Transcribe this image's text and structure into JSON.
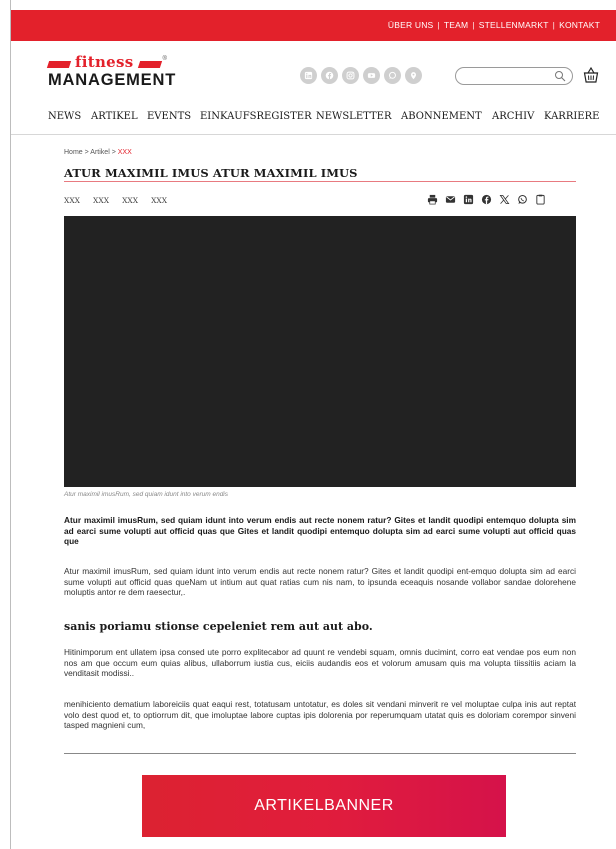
{
  "colors": {
    "brand_red": "#e3212b",
    "video_bg": "#222222",
    "icon_grey": "#cfcfcf"
  },
  "topbar": {
    "links": [
      "ÜBER UNS",
      "TEAM",
      "STELLENMARKT",
      "KONTAKT"
    ],
    "separator": "|"
  },
  "logo": {
    "word_top": "fitness",
    "word_bottom": "MANAGEMENT",
    "reg": "®"
  },
  "social_icons": [
    "linkedin-icon",
    "facebook-icon",
    "instagram-icon",
    "youtube-icon",
    "whatsapp-icon",
    "location-pin-icon"
  ],
  "search": {
    "placeholder": "",
    "value": ""
  },
  "nav": [
    "NEWS",
    "ARTIKEL",
    "EVENTS",
    "EINKAUFSREGISTER",
    "NEWSLETTER",
    "ABONNEMENT",
    "ARCHIV",
    "KARRIERE"
  ],
  "breadcrumb": {
    "home": "Home",
    "sep": ">",
    "section": "Artikel",
    "current": "XXX"
  },
  "article": {
    "title": "ATUR MAXIMIL IMUS ATUR MAXIMIL IMUS",
    "tags": [
      "XXX",
      "XXX",
      "XXX",
      "XXX"
    ],
    "share_icons": [
      "print-icon",
      "mail-icon",
      "linkedin-icon",
      "facebook-icon",
      "x-icon",
      "whatsapp-icon",
      "copy-icon"
    ],
    "caption": "Atur maximil imusRum, sed quiam idunt into verum endis",
    "lead": "Atur maximil imusRum, sed quiam idunt into verum endis aut recte nonem ratur? Gites et landit quodipi entemquo dolupta sim ad earci sume volupti aut officid quas que Gites et landit quodipi entemquo dolupta sim ad earci sume volupti aut officid quas que",
    "p1": "Atur maximil imusRum, sed quiam idunt into verum endis aut recte nonem ratur? Gites et landit quodipi ent-emquo dolupta sim ad earci sume volupti aut officid quas queNam ut intium aut quat ratias cum nis nam, to ipsunda eceaquis nosande vollabor sandae dolorehene moluptis antor re dem raesectur,.",
    "subhead": "sanis poriamu stionse cepeleniet rem aut aut abo.",
    "p2": "Hitinimporum ent ullatem ipsa consed ute porro explitecabor ad quunt re vendebi squam, omnis ducimint, corro eat vendae pos eum non nos am que occum eum quias alibus, ullaborrum iustia cus, eiciis audandis eos et volorum amusam quis ma volupta tiissitiis aciam la venditasit modissi..",
    "p3": "menihiciento dematium laboreiciis quat eaqui rest, totatusam untotatur, es doles sit vendani minverit re vel moluptae culpa inis aut reptat volo dest quod et, to optiorrum dit, que imoluptae labore cuptas ipis dolorenia por reperumquam utatat quis es doloriam corempor sinveni tasped magnieni cum,"
  },
  "banner": {
    "label": "ARTIKELBANNER"
  }
}
